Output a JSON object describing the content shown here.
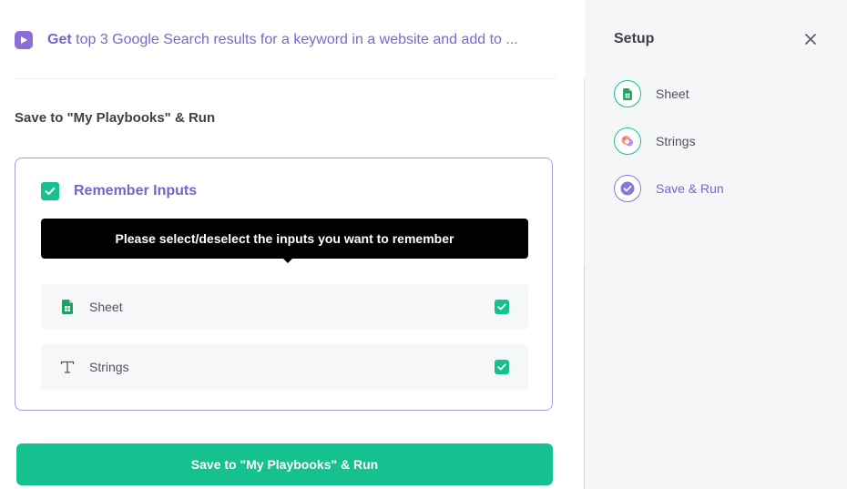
{
  "header": {
    "verb": "Get",
    "description": "top 3 Google Search results for a keyword in a website and add to ..."
  },
  "section_title": "Save to \"My Playbooks\" & Run",
  "remember": {
    "label": "Remember Inputs",
    "checked": true,
    "tooltip": "Please select/deselect the inputs you want to remember",
    "inputs": [
      {
        "label": "Sheet",
        "icon": "google-sheets-icon",
        "checked": true
      },
      {
        "label": "Strings",
        "icon": "text-t-icon",
        "checked": true
      }
    ]
  },
  "run_button_label": "Save to \"My Playbooks\" & Run",
  "sidebar": {
    "title": "Setup",
    "steps": [
      {
        "label": "Sheet",
        "icon": "google-sheets-icon",
        "state": "done"
      },
      {
        "label": "Strings",
        "icon": "strings-app-icon",
        "state": "done"
      },
      {
        "label": "Save & Run",
        "icon": "check-circle-icon",
        "state": "active"
      }
    ]
  },
  "colors": {
    "accent_purple": "#7a62cc",
    "accent_green": "#14c18f",
    "tooltip_bg": "#000000",
    "sidebar_bg": "#f5f6f8"
  }
}
